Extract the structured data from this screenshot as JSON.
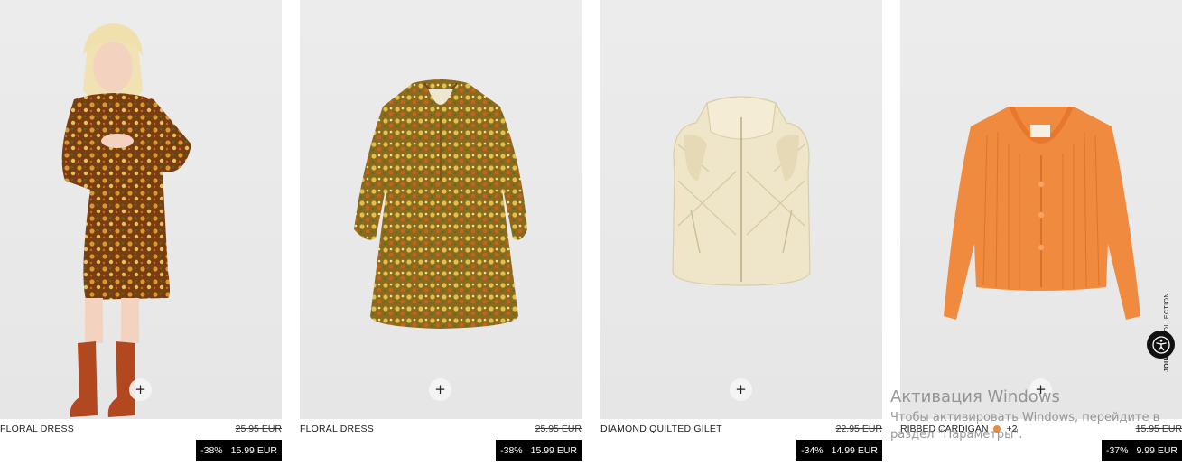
{
  "products": [
    {
      "name": "FLORAL DRESS",
      "old_price": "25.95 EUR",
      "discount": "-38%",
      "price": "15.99 EUR"
    },
    {
      "name": "FLORAL DRESS",
      "old_price": "25.95 EUR",
      "discount": "-38%",
      "price": "15.99 EUR"
    },
    {
      "name": "DIAMOND QUILTED GILET",
      "old_price": "22.95 EUR",
      "discount": "-34%",
      "price": "14.99 EUR"
    },
    {
      "name": "RIBBED CARDIGAN",
      "colors_more": "+2",
      "old_price": "15.95 EUR",
      "discount": "-37%",
      "price": "9.99 EUR"
    }
  ],
  "add_button": "+",
  "join_tab": {
    "bold": "JOIN",
    "rest": "LIFE COLLECTION"
  },
  "accessibility": {
    "icon": "accessibility-icon"
  },
  "colors": {
    "price_bg": "#000000",
    "swatch": "#ee8a3c",
    "accessibility_bg": "#111111"
  },
  "windows_watermark": {
    "title": "Активация Windows",
    "line1": "Чтобы активировать Windows, перейдите в",
    "line2": "раздел \"Параметры\"."
  }
}
